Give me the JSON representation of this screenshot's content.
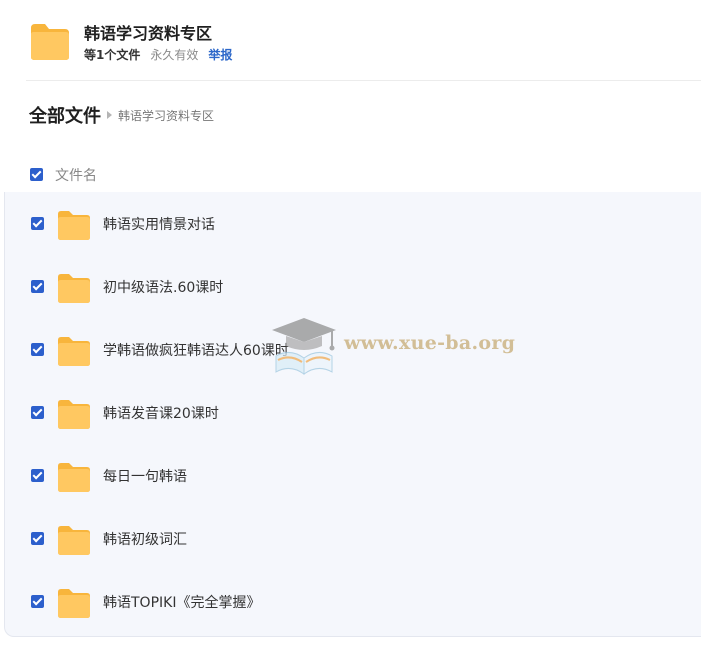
{
  "share": {
    "title": "韩语学习资料专区",
    "file_count": "等1个文件",
    "validity": "永久有效",
    "report_label": "举报"
  },
  "breadcrumb": {
    "root": "全部文件",
    "current": "韩语学习资料专区"
  },
  "list": {
    "column_header": "文件名",
    "items": [
      {
        "name": "韩语实用情景对话",
        "checked": true,
        "icon": "folder-icon"
      },
      {
        "name": "初中级语法.60课时",
        "checked": true,
        "icon": "folder-icon"
      },
      {
        "name": "学韩语做疯狂韩语达人60课时",
        "checked": true,
        "icon": "folder-icon"
      },
      {
        "name": "韩语发音课20课时",
        "checked": true,
        "icon": "folder-icon"
      },
      {
        "name": "每日一句韩语",
        "checked": true,
        "icon": "folder-icon"
      },
      {
        "name": "韩语初级词汇",
        "checked": true,
        "icon": "folder-icon"
      },
      {
        "name": "韩语TOPIKI《完全掌握》",
        "checked": true,
        "icon": "folder-icon"
      }
    ]
  },
  "watermark": {
    "text": "www.xue-ba.org",
    "icon": "graduation-cap-book-icon"
  },
  "colors": {
    "folder": "#ffc861",
    "checkbox": "#2c5fcc",
    "link": "#2c67c9",
    "list_background": "#f5f7fc"
  }
}
